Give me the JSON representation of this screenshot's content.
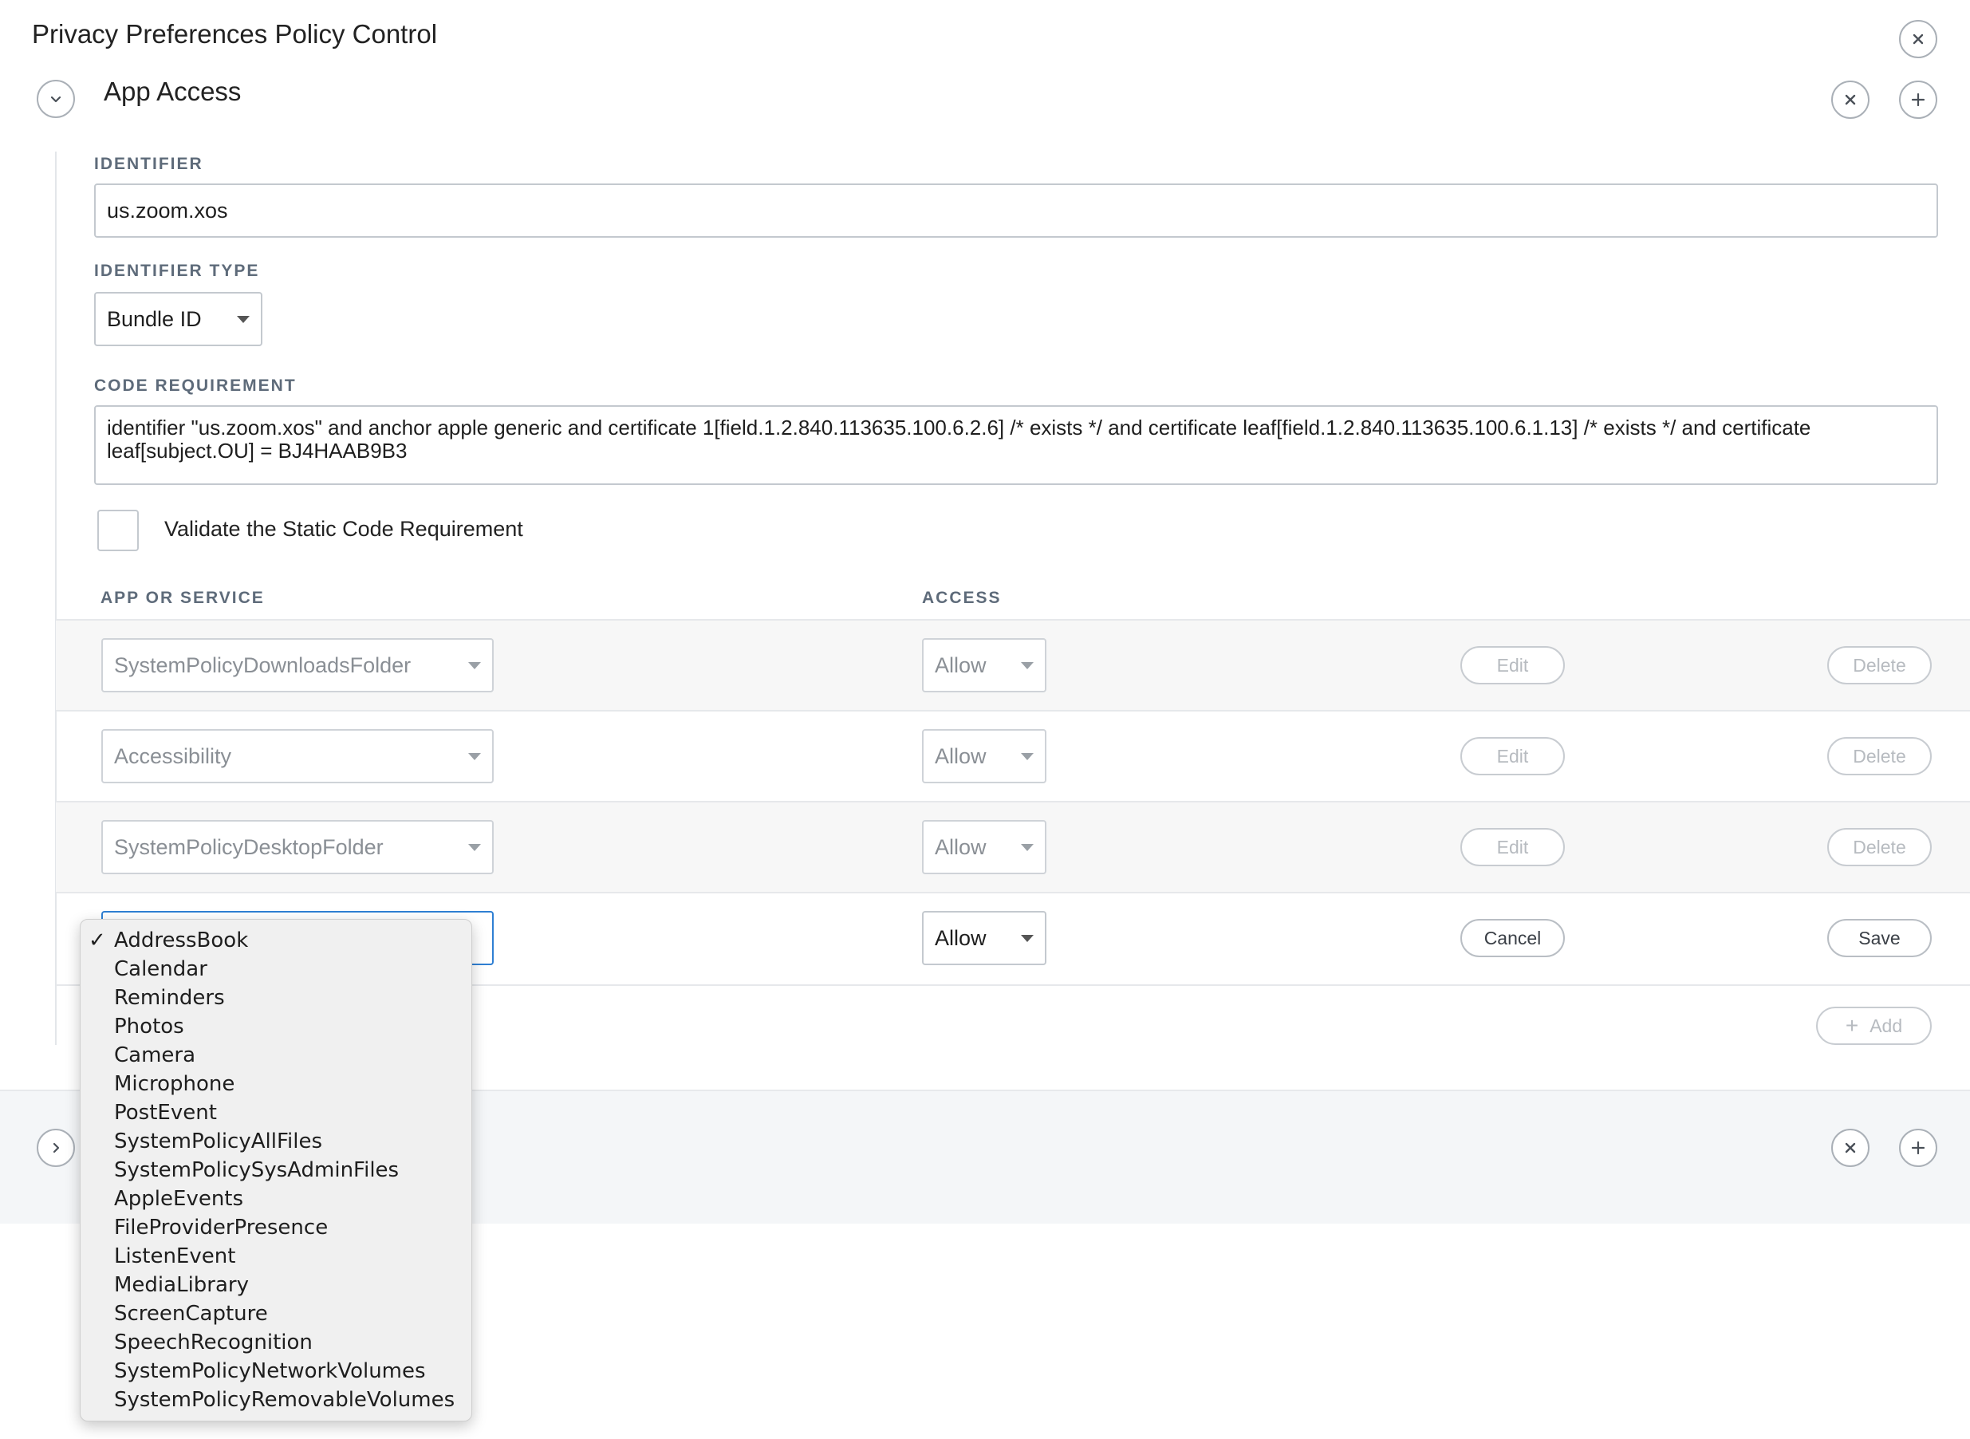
{
  "header": {
    "title": "Privacy Preferences Policy Control"
  },
  "section": {
    "title": "App Access"
  },
  "identifier": {
    "label": "IDENTIFIER",
    "value": "us.zoom.xos"
  },
  "identifier_type": {
    "label": "IDENTIFIER TYPE",
    "value": "Bundle ID"
  },
  "code_requirement": {
    "label": "CODE REQUIREMENT",
    "value": "identifier \"us.zoom.xos\" and anchor apple generic and certificate 1[field.1.2.840.113635.100.6.2.6] /* exists */ and certificate leaf[field.1.2.840.113635.100.6.1.13] /* exists */ and certificate leaf[subject.OU] = BJ4HAAB9B3"
  },
  "validate": {
    "label": "Validate the Static Code Requirement",
    "checked": false
  },
  "table": {
    "col_service": "APP OR SERVICE",
    "col_access": "ACCESS",
    "rows": [
      {
        "service": "SystemPolicyDownloadsFolder",
        "access": "Allow",
        "edit": "Edit",
        "delete": "Delete"
      },
      {
        "service": "Accessibility",
        "access": "Allow",
        "edit": "Edit",
        "delete": "Delete"
      },
      {
        "service": "SystemPolicyDesktopFolder",
        "access": "Allow",
        "edit": "Edit",
        "delete": "Delete"
      }
    ],
    "editing_row": {
      "access": "Allow",
      "cancel": "Cancel",
      "save": "Save"
    },
    "add_label": "Add"
  },
  "dropdown": {
    "selected": "AddressBook",
    "check": "✓",
    "options": [
      "AddressBook",
      "Calendar",
      "Reminders",
      "Photos",
      "Camera",
      "Microphone",
      "PostEvent",
      "SystemPolicyAllFiles",
      "SystemPolicySysAdminFiles",
      "AppleEvents",
      "FileProviderPresence",
      "ListenEvent",
      "MediaLibrary",
      "ScreenCapture",
      "SpeechRecognition",
      "SystemPolicyNetworkVolumes",
      "SystemPolicyRemovableVolumes"
    ]
  },
  "icons": {
    "close": "close-icon",
    "add": "plus-icon",
    "collapse": "chevron-down-icon",
    "expand": "chevron-right-icon",
    "dropdown": "caret-down-icon"
  },
  "colors": {
    "focus": "#2f7fd3",
    "label": "#5e6b7a",
    "border": "#c4c9cf"
  }
}
